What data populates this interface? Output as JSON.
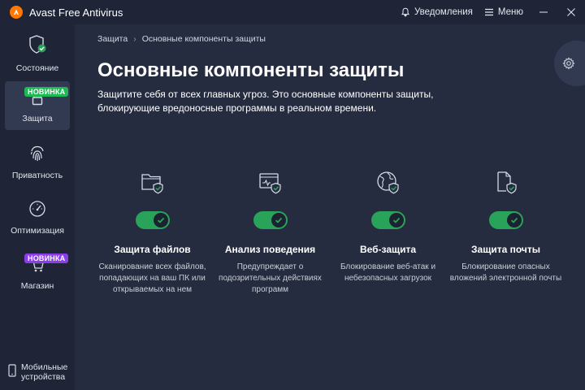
{
  "app": {
    "title": "Avast Free Antivirus"
  },
  "titlebar": {
    "notifications_label": "Уведомления",
    "menu_label": "Меню"
  },
  "sidebar": {
    "items": [
      {
        "label": "Состояние",
        "icon": "shield-check-icon",
        "badge": ""
      },
      {
        "label": "Защита",
        "icon": "lock-icon",
        "badge": "НОВИНКА",
        "active": true
      },
      {
        "label": "Приватность",
        "icon": "fingerprint-icon",
        "badge": ""
      },
      {
        "label": "Оптимизация",
        "icon": "speedometer-icon",
        "badge": ""
      },
      {
        "label": "Магазин",
        "icon": "cart-icon",
        "badge": "НОВИНКА"
      }
    ],
    "mobile_label_line1": "Мобильные",
    "mobile_label_line2": "устройства"
  },
  "breadcrumb": {
    "root": "Защита",
    "separator": "›",
    "current": "Основные компоненты защиты"
  },
  "page": {
    "title": "Основные компоненты защиты",
    "description": "Защитите себя от всех главных угроз. Это основные компоненты защиты, блокирующие вредоносные программы в реальном времени."
  },
  "components": [
    {
      "title": "Защита файлов",
      "description": "Сканирование всех файлов, попадающих на ваш ПК или открываемых на нем",
      "enabled": true,
      "icon": "folder-shield-icon"
    },
    {
      "title": "Анализ поведения",
      "description": "Предупреждает о подозрительных действиях программ",
      "enabled": true,
      "icon": "monitor-shield-icon"
    },
    {
      "title": "Веб-защита",
      "description": "Блокирование веб-атак и небезопасных загрузок",
      "enabled": true,
      "icon": "globe-shield-icon"
    },
    {
      "title": "Защита почты",
      "description": "Блокирование опасных вложений электронной почты",
      "enabled": true,
      "icon": "mail-shield-icon"
    }
  ],
  "colors": {
    "accent_green": "#2aa35a",
    "badge_green": "#1db954",
    "badge_purple": "#8a3ee8",
    "brand_orange": "#ff7800",
    "background": "#262c40",
    "sidebar": "#1f2536"
  }
}
